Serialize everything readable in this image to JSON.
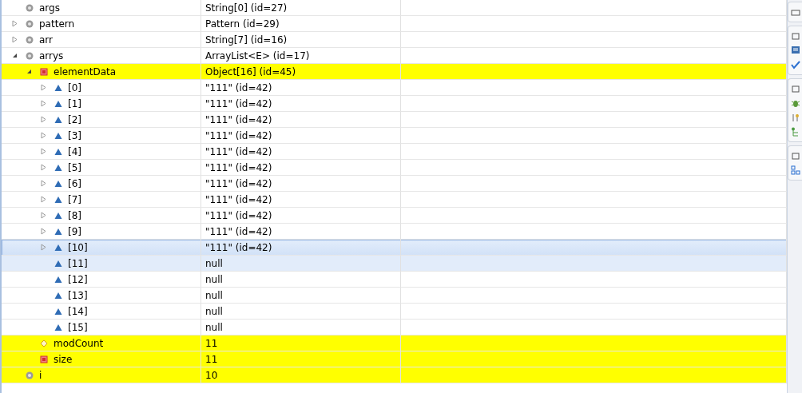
{
  "variables": [
    {
      "name": "args",
      "value": "String[0]  (id=27)",
      "kind": "local",
      "changed": false,
      "selected": false,
      "hovered": false
    },
    {
      "name": "pattern",
      "value": "Pattern  (id=29)",
      "kind": "local",
      "expanded": false,
      "changed": false,
      "selected": false,
      "hovered": false
    },
    {
      "name": "arr",
      "value": "String[7]  (id=16)",
      "kind": "local",
      "expanded": false,
      "changed": false,
      "selected": false,
      "hovered": false
    },
    {
      "name": "arrys",
      "value": "ArrayList<E>  (id=17)",
      "kind": "local",
      "expanded": true,
      "changed": false,
      "selected": false,
      "hovered": false,
      "children": [
        {
          "name": "elementData",
          "value": "Object[16]  (id=45)",
          "kind": "private",
          "expanded": true,
          "changed": true,
          "selected": false,
          "hovered": false,
          "children": [
            {
              "name": "[0]",
              "value": "\"111\" (id=42)",
              "kind": "public",
              "expanded": false,
              "changed": false,
              "selected": false,
              "hovered": false
            },
            {
              "name": "[1]",
              "value": "\"111\" (id=42)",
              "kind": "public",
              "expanded": false,
              "changed": false,
              "selected": false,
              "hovered": false
            },
            {
              "name": "[2]",
              "value": "\"111\" (id=42)",
              "kind": "public",
              "expanded": false,
              "changed": false,
              "selected": false,
              "hovered": false
            },
            {
              "name": "[3]",
              "value": "\"111\" (id=42)",
              "kind": "public",
              "expanded": false,
              "changed": false,
              "selected": false,
              "hovered": false
            },
            {
              "name": "[4]",
              "value": "\"111\" (id=42)",
              "kind": "public",
              "expanded": false,
              "changed": false,
              "selected": false,
              "hovered": false
            },
            {
              "name": "[5]",
              "value": "\"111\" (id=42)",
              "kind": "public",
              "expanded": false,
              "changed": false,
              "selected": false,
              "hovered": false
            },
            {
              "name": "[6]",
              "value": "\"111\" (id=42)",
              "kind": "public",
              "expanded": false,
              "changed": false,
              "selected": false,
              "hovered": false
            },
            {
              "name": "[7]",
              "value": "\"111\" (id=42)",
              "kind": "public",
              "expanded": false,
              "changed": false,
              "selected": false,
              "hovered": false
            },
            {
              "name": "[8]",
              "value": "\"111\" (id=42)",
              "kind": "public",
              "expanded": false,
              "changed": false,
              "selected": false,
              "hovered": false
            },
            {
              "name": "[9]",
              "value": "\"111\" (id=42)",
              "kind": "public",
              "expanded": false,
              "changed": false,
              "selected": false,
              "hovered": false
            },
            {
              "name": "[10]",
              "value": "\"111\" (id=42)",
              "kind": "public",
              "expanded": false,
              "changed": false,
              "selected": true,
              "hovered": false
            },
            {
              "name": "[11]",
              "value": "null",
              "kind": "public",
              "changed": false,
              "selected": false,
              "hovered": true
            },
            {
              "name": "[12]",
              "value": "null",
              "kind": "public",
              "changed": false,
              "selected": false,
              "hovered": false
            },
            {
              "name": "[13]",
              "value": "null",
              "kind": "public",
              "changed": false,
              "selected": false,
              "hovered": false
            },
            {
              "name": "[14]",
              "value": "null",
              "kind": "public",
              "changed": false,
              "selected": false,
              "hovered": false
            },
            {
              "name": "[15]",
              "value": "null",
              "kind": "public",
              "changed": false,
              "selected": false,
              "hovered": false
            }
          ]
        },
        {
          "name": "modCount",
          "value": "11",
          "kind": "default",
          "changed": true,
          "selected": false,
          "hovered": false
        },
        {
          "name": "size",
          "value": "11",
          "kind": "private",
          "changed": true,
          "selected": false,
          "hovered": false
        }
      ]
    },
    {
      "name": "i",
      "value": "10",
      "kind": "local",
      "changed": true,
      "selected": false,
      "hovered": false
    }
  ]
}
